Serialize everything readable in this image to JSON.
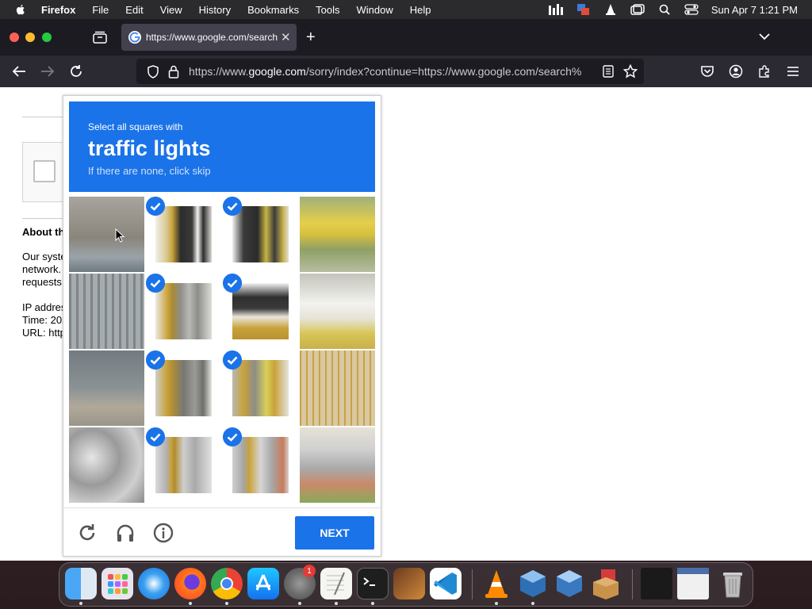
{
  "menubar": {
    "app_name": "Firefox",
    "items": [
      "File",
      "Edit",
      "View",
      "History",
      "Bookmarks",
      "Tools",
      "Window",
      "Help"
    ],
    "clock": "Sun Apr 7  1:21 PM"
  },
  "browser": {
    "tab_title": "https://www.google.com/search",
    "url_prefix": "https://www.",
    "url_domain": "google.com",
    "url_rest": "/sorry/index?continue=https://www.google.com/search%"
  },
  "page": {
    "about_heading": "About th",
    "body_lines": [
      "Our syste",
      "network.",
      "requests",
      "",
      "IP addres",
      "Time: 202",
      "URL: http"
    ]
  },
  "captcha": {
    "instruction": "Select all squares with",
    "target": "traffic lights",
    "hint": "If there are none, click skip",
    "next_label": "NEXT",
    "selected_grid": [
      [
        false,
        true,
        true,
        false
      ],
      [
        false,
        true,
        true,
        false
      ],
      [
        false,
        true,
        true,
        false
      ],
      [
        false,
        true,
        true,
        false
      ]
    ]
  },
  "dock": {
    "apps": [
      "finder-icon",
      "launchpad-icon",
      "safari-icon",
      "firefox-icon",
      "chrome-icon",
      "app-store-icon",
      "system-settings-icon",
      "textedit-icon",
      "terminal-icon",
      "garageband-icon",
      "vscode-icon",
      "vlc-icon",
      "virtualbox-icon",
      "virtualbox-vm-icon",
      "archive-utility-icon",
      "screenshot-thumb-icon",
      "chrome-window-thumb-icon",
      "trash-icon"
    ],
    "settings_badge": "1"
  }
}
